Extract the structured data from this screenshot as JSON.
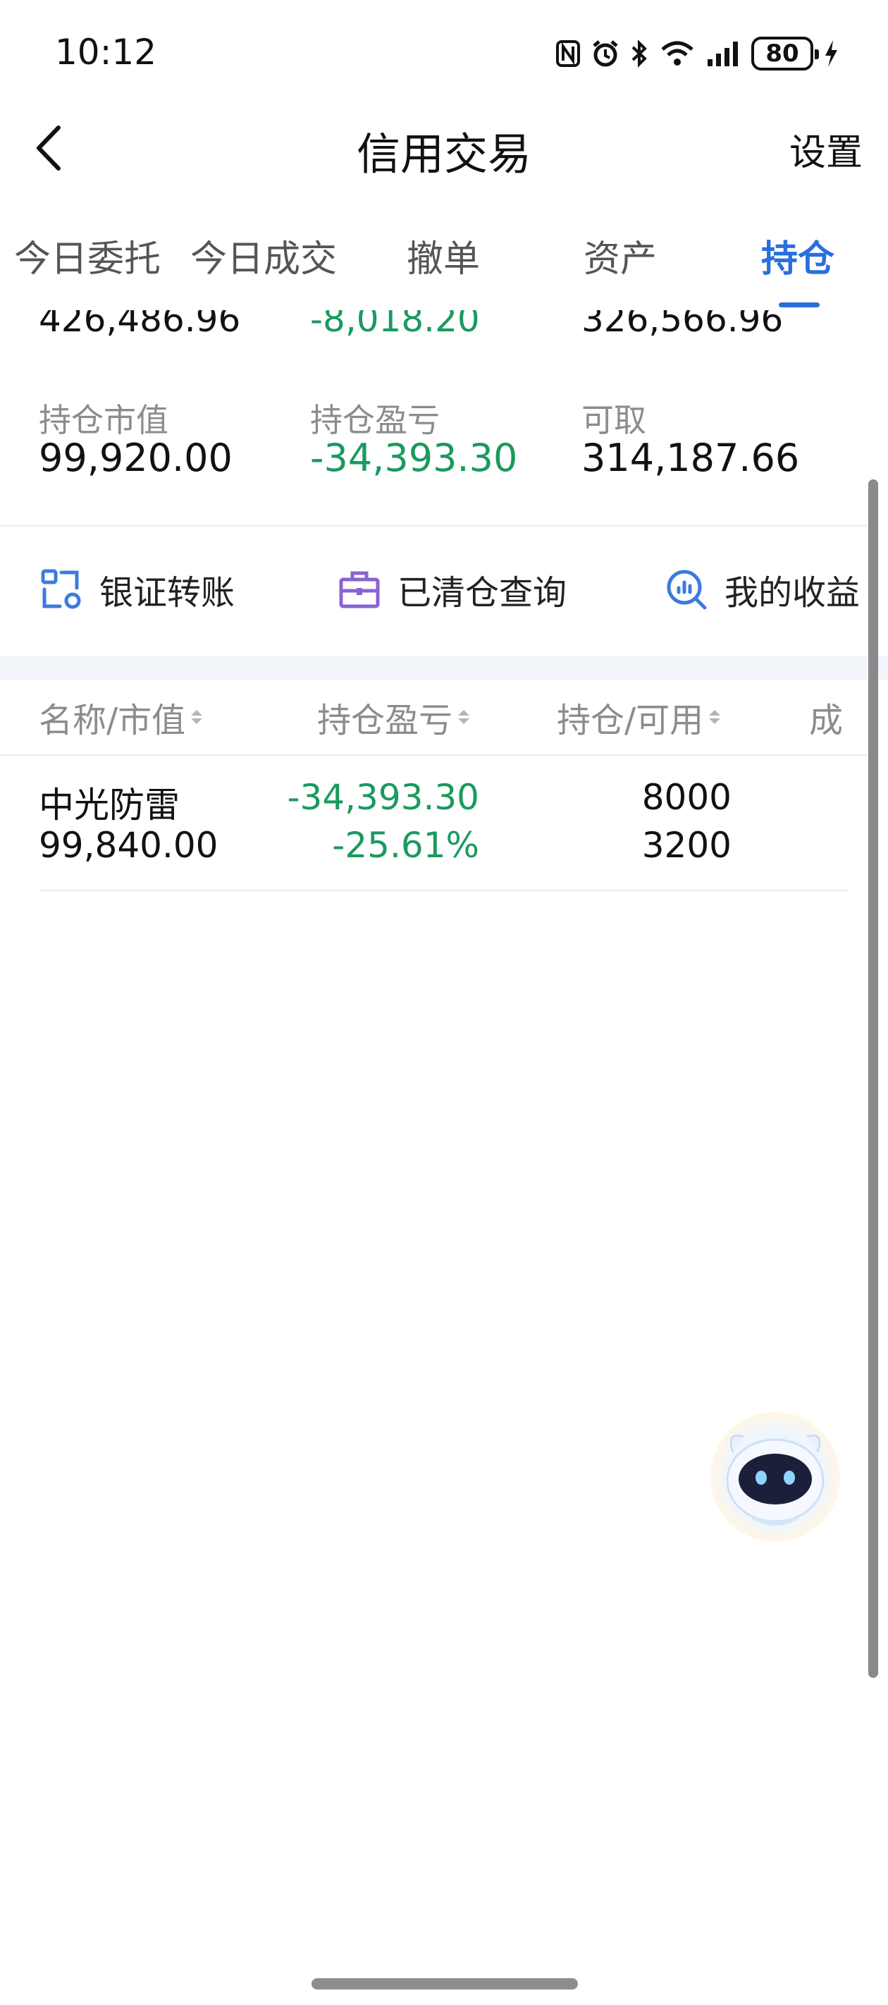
{
  "status_bar": {
    "time": "10:12",
    "battery": "80"
  },
  "nav": {
    "title": "信用交易",
    "settings_label": "设置"
  },
  "tabs": [
    {
      "label": "今日委托"
    },
    {
      "label": "今日成交"
    },
    {
      "label": "撤单"
    },
    {
      "label": "资产"
    },
    {
      "label": "持仓",
      "active": true
    }
  ],
  "summary": {
    "partial_values": [
      "426,486.96",
      "-8,018.20",
      "326,566.96"
    ],
    "items": [
      {
        "label": "持仓市值",
        "value": "99,920.00"
      },
      {
        "label": "持仓盈亏",
        "value": "-34,393.30"
      },
      {
        "label": "可取",
        "value": "314,187.66"
      }
    ]
  },
  "actions": [
    {
      "label": "银证转账",
      "icon": "bank-transfer-icon"
    },
    {
      "label": "已清仓查询",
      "icon": "briefcase-icon"
    },
    {
      "label": "我的收益",
      "icon": "earnings-search-icon"
    }
  ],
  "table": {
    "headers": [
      "名称/市值",
      "持仓盈亏",
      "持仓/可用",
      "成"
    ],
    "rows": [
      {
        "name": "中光防雷",
        "market_value": "99,840.00",
        "pnl": "-34,393.30",
        "pnl_pct": "-25.61%",
        "position": "8000",
        "available": "3200"
      }
    ]
  },
  "colors": {
    "accent": "#2a6fdb",
    "loss": "#1a9a5e",
    "label": "#8c8c8c"
  }
}
